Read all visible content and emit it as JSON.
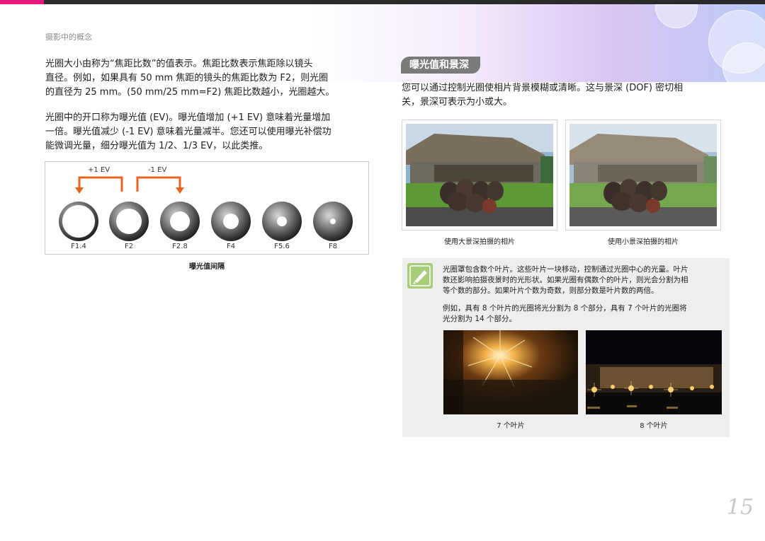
{
  "header": {
    "breadcrumb": "摄影中的概念"
  },
  "left": {
    "para1": [
      "光圈大小由称为“焦距比数”的值表示。焦距比数表示焦距除以镜头",
      "直径。例如，如果具有 50 mm 焦距的镜头的焦距比数为 F2，则光圈",
      "的直径为 25 mm。(50 mm/25 mm=F2) 焦距比数越小，光圈越大。"
    ],
    "para2": [
      "光圈中的开口称为曝光值 (EV)。曝光值增加 (+1 EV) 意味着光量增加",
      "一倍。曝光值减少 (-1 EV) 意味着光量减半。您还可以使用曝光补偿功",
      "能微调光量，细分曝光值为 1/2、1/3 EV，以此类推。"
    ],
    "ev_figure": {
      "plus_label": "+1 EV",
      "minus_label": "-1 EV",
      "stops": [
        "F1.4",
        "F2",
        "F2.8",
        "F4",
        "F5.6",
        "F8"
      ],
      "caption": "曝光值间隔",
      "accent_color": "#e8641e"
    }
  },
  "right": {
    "section_title": "曝光值和景深",
    "intro": [
      "您可以通过控制光圈使相片背景模糊或清晰。这与景深 (DOF) 密切相",
      "关，景深可表示为小或大。"
    ],
    "photo_captions": [
      "使用大景深拍摄的相片",
      "使用小景深拍摄的相片"
    ],
    "note": {
      "icon": "pen-icon",
      "para1": [
        "光圈罩包含数个叶片。这些叶片一块移动，控制通过光圈中心的光量。叶片",
        "数还影响拍摄夜景时的光形状。如果光圈有偶数个的叶片，则光会分割为相",
        "等个数的部分。如果叶片个数为奇数，则部分数是叶片数的两倍。"
      ],
      "para2": [
        "例如，具有 8 个叶片的光圈将光分割为 8 个部分，具有 7 个叶片的光圈将",
        "光分割为 14 个部分。"
      ],
      "captions": [
        "7 个叶片",
        "8 个叶片"
      ]
    }
  },
  "page_number": "15"
}
